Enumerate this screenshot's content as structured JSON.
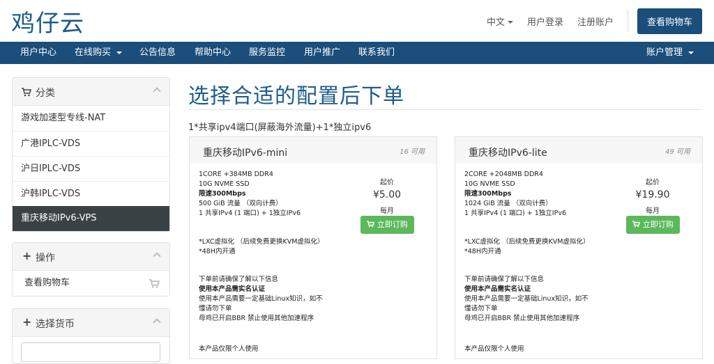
{
  "header": {
    "logo": "鸡仔云",
    "language": "中文",
    "login": "用户登录",
    "register": "注册账户",
    "view_cart": "查看购物车"
  },
  "nav": {
    "items": [
      "用户中心",
      "在线购买",
      "公告信息",
      "帮助中心",
      "服务监控",
      "用户推广",
      "联系我们"
    ],
    "account": "账户管理"
  },
  "sidebar": {
    "category_title": "分类",
    "categories": [
      "游戏加速型专线-NAT",
      "广港IPLC-VDS",
      "沪日IPLC-VDS",
      "沪韩IPLC-VDS",
      "重庆移动IPv6-VPS"
    ],
    "actions_title": "操作",
    "actions": [
      "查看购物车"
    ],
    "currency_title": "选择货币"
  },
  "main": {
    "title": "选择合适的配置后下单",
    "description": "1*共享ipv4端口(屏蔽海外流量)+1*独立ipv6"
  },
  "products": [
    {
      "name": "重庆移动IPv6-mini",
      "available": "16 可用",
      "specs": [
        "1CORE +384MB DDR4",
        "10G NVME SSD",
        "限速300Mbps",
        "500 GiB 流量 （双向计费）",
        "1 共享IPv4 (1 端口) + 1独立IPv6"
      ],
      "price_from": "起价",
      "price": "¥5.00",
      "period": "每月",
      "order": "立即订购",
      "virt": [
        "*LXC虚拟化 （后续免费更换KVM虚拟化）",
        "*48H内开通"
      ],
      "notes": [
        "下单前请确保了解以下信息",
        "使用本产品需实名认证",
        "使用本产品需要一定基础Linux知识，如不",
        "懂请勿下单",
        "母鸡已开启BBR 禁止使用其他加速程序"
      ],
      "personal": "本产品仅限个人使用"
    },
    {
      "name": "重庆移动IPv6-lite",
      "available": "49 可用",
      "specs": [
        "2CORE +2048MB DDR4",
        "10G NVME SSD",
        "限速300Mbps",
        "1024 GiB 流量 （双向计费）",
        "1 共享IPv4 (1 端口) + 1独立IPv6"
      ],
      "price_from": "起价",
      "price": "¥19.90",
      "period": "每月",
      "order": "立即订购",
      "virt": [
        "*LXC虚拟化 （后续免费更换KVM虚拟化）",
        "*48H内开通"
      ],
      "notes": [
        "下单前请确保了解以下信息",
        "使用本产品需实名认证",
        "使用本产品需要一定基础Linux知识，如不",
        "懂请勿下单",
        "母鸡已开启BBR 禁止使用其他加速程序"
      ],
      "personal": "本产品仅限个人使用"
    }
  ],
  "colors": {
    "brand": "#1b4e7a",
    "title": "#1e5b8a",
    "order_button": "#5cb85c",
    "active_item": "#3b4246"
  }
}
